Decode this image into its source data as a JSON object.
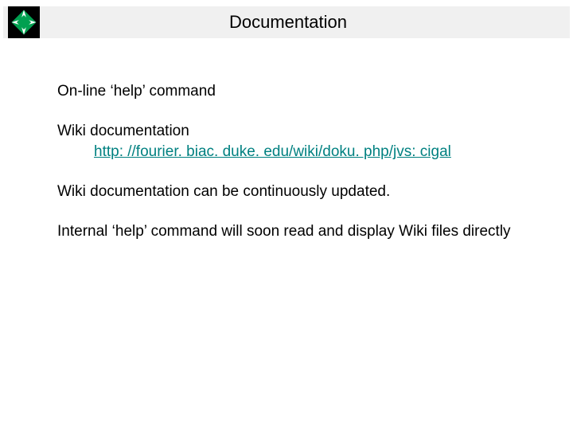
{
  "header": {
    "title": "Documentation",
    "logo_name": "cigal-logo"
  },
  "body": {
    "line_help": "On-line ‘help’ command",
    "wiki_label": "Wiki documentation",
    "wiki_url": "http: //fourier. biac. duke. edu/wiki/doku. php/jvs: cigal",
    "wiki_updated": "Wiki documentation can be continuously updated.",
    "internal_help": "Internal ‘help’ command will soon read and display Wiki files directly"
  },
  "colors": {
    "accent": "#00a050",
    "link": "#008080",
    "title_bg": "#f0f0f0"
  }
}
